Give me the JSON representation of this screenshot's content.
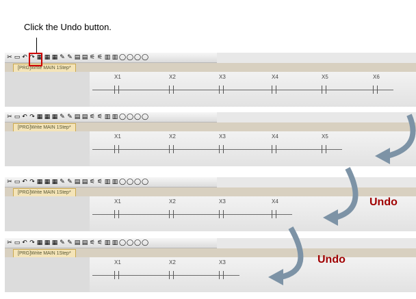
{
  "callout": {
    "text": "Click the Undo button."
  },
  "tab_label": "[PRG]Write MAIN 1Step*",
  "toolbar_icons": [
    "✂",
    "▭",
    "↶",
    "↷",
    "▦",
    "▦",
    "▦",
    "✎",
    "✎",
    "▤",
    "▤",
    "⚟",
    "⚟",
    "▥",
    "▥",
    "◯",
    "◯",
    "◯",
    "◯"
  ],
  "panels": [
    {
      "contacts": [
        "X1",
        "X2",
        "X3",
        "X4",
        "X5",
        "X6"
      ]
    },
    {
      "contacts": [
        "X1",
        "X2",
        "X3",
        "X4",
        "X5"
      ]
    },
    {
      "contacts": [
        "X1",
        "X2",
        "X3",
        "X4"
      ]
    },
    {
      "contacts": [
        "X1",
        "X2",
        "X3"
      ]
    }
  ],
  "undo_labels": [
    "Undo",
    "Undo"
  ],
  "colors": {
    "arrow": "#7d93a6",
    "undo_text": "#a00000",
    "highlight": "#cc0000"
  }
}
